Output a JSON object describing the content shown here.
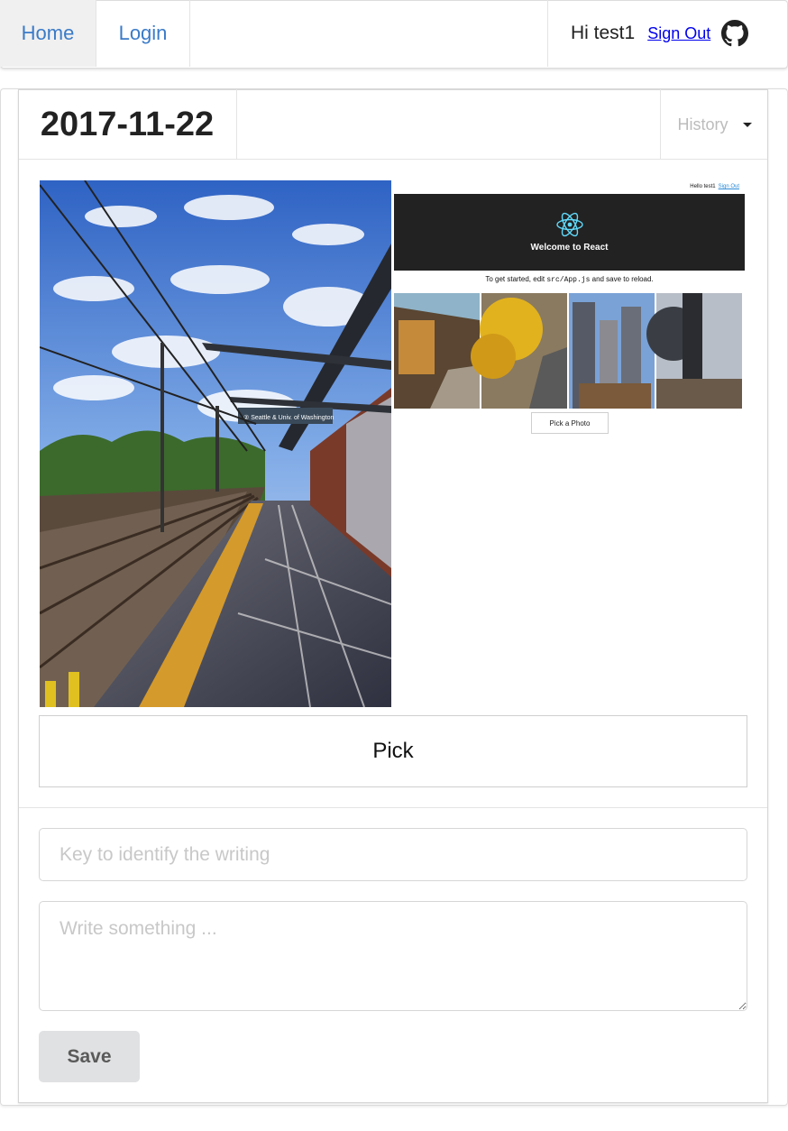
{
  "nav": {
    "home": "Home",
    "login": "Login",
    "greeting": "Hi test1",
    "sign_out": "Sign Out",
    "github_icon": "github-icon"
  },
  "entry": {
    "date": "2017-11-22",
    "history_label": "History",
    "pick_label": "Pick",
    "key_placeholder": "Key to identify the writing",
    "write_placeholder": "Write something ...",
    "save_label": "Save"
  },
  "photo_sign": "② Seattle & Univ. of Washington",
  "embedded_screenshot": {
    "greeting": "Hello test1",
    "sign_out": "Sign Out",
    "title": "Welcome to React",
    "intro_before": "To get started, edit ",
    "intro_code": "src/App.js",
    "intro_after": " and save to reload.",
    "pick_button": "Pick a Photo"
  },
  "colors": {
    "link": "#3a7bc8",
    "react_blue": "#61dafb",
    "header_dark": "#222222"
  }
}
